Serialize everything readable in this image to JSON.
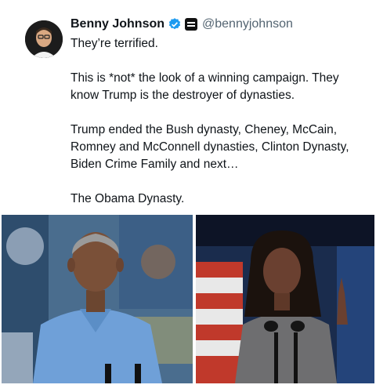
{
  "tweet": {
    "author": {
      "display_name": "Benny Johnson",
      "handle": "@bennyjohnson",
      "verified_icon": "verified-badge-icon",
      "affiliation_icon": "affiliation-badge-icon"
    },
    "paragraphs": [
      "They’re terrified.",
      "This is *not* the look of a winning campaign. They know Trump is the destroyer of dynasties.",
      "Trump ended the Bush dynasty, Cheney, McCain, Romney and McConnell dynasties, Clinton Dynasty, Biden Crime Family and next…",
      "The Obama Dynasty."
    ],
    "media": [
      {
        "alt": "photo-man-blue-shirt"
      },
      {
        "alt": "photo-woman-podium"
      }
    ]
  },
  "colors": {
    "verified_blue": "#1d9bf0",
    "handle_gray": "#536471",
    "text": "#0f1419"
  }
}
